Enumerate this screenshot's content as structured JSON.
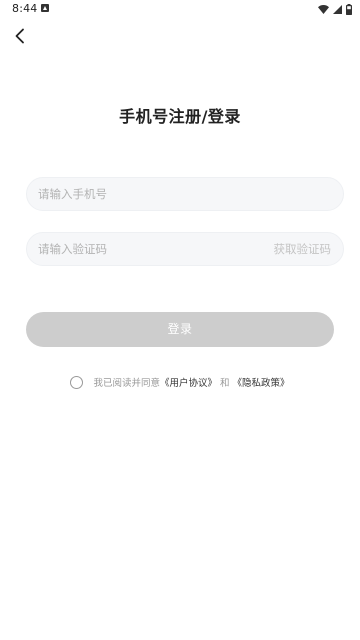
{
  "status_bar": {
    "time": "8:44",
    "icons": [
      "notification-icon",
      "wifi-icon",
      "signal-icon",
      "battery-icon"
    ]
  },
  "header": {
    "back_icon": "chevron-left-icon"
  },
  "login": {
    "title": "手机号注册/登录",
    "phone_placeholder": "请输入手机号",
    "code_placeholder": "请输入验证码",
    "get_code_label": "获取验证码",
    "submit_label": "登录",
    "agreement": {
      "prefix": "我已阅读并同意",
      "user_agreement": "《用户协议》",
      "and": "和",
      "privacy_policy": "《隐私政策》"
    }
  },
  "colors": {
    "title": "#222222",
    "input_bg": "#f6f7f9",
    "placeholder": "#b3b3b3",
    "button_disabled": "#cdcdcd",
    "muted_text": "#9a9a9a",
    "link_text": "#333333"
  }
}
